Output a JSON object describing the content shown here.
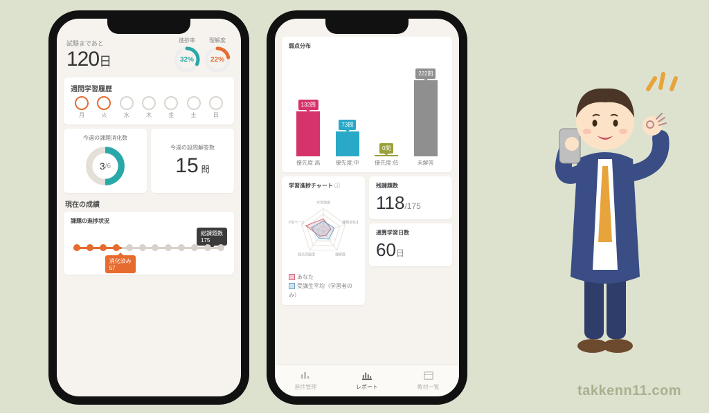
{
  "watermark": "takkenn11.com",
  "left": {
    "countdown": {
      "label": "試験まであと",
      "value": "120",
      "unit": "日"
    },
    "rings": [
      {
        "caption": "進捗率",
        "pct": 32,
        "text": "32%",
        "color": "#2aa8a8"
      },
      {
        "caption": "理解度",
        "pct": 22,
        "text": "22%",
        "color": "#e66b2e"
      }
    ],
    "weekly": {
      "title": "週間学習履歴",
      "days": [
        {
          "label": "月",
          "active": true
        },
        {
          "label": "火",
          "active": true
        },
        {
          "label": "水",
          "active": false
        },
        {
          "label": "木",
          "active": false
        },
        {
          "label": "金",
          "active": false
        },
        {
          "label": "土",
          "active": false
        },
        {
          "label": "日",
          "active": false
        }
      ]
    },
    "cards": {
      "tasks": {
        "title": "今週の課題消化数",
        "done": 3,
        "total": 6
      },
      "answers": {
        "title": "今週の設問解答数",
        "value": "15",
        "unit": "問"
      }
    },
    "grades_title": "現在の成績",
    "progress": {
      "title": "課題の進捗状況",
      "total_label": "総課題数",
      "total_value": "175",
      "done_label": "消化済み",
      "done_value": "57",
      "done_pct": 32,
      "dots_total": 12,
      "dots_done": 4
    }
  },
  "right": {
    "dist_title": "弱点分布",
    "remaining": {
      "title": "残課題数",
      "value": "118",
      "total": "/175"
    },
    "studydays": {
      "title": "通算学習日数",
      "value": "60",
      "unit": "日"
    },
    "radar": {
      "title": "学習進捗チャート",
      "axes": [
        "学習頻度",
        "課題消化率",
        "理解度",
        "弱点克服度",
        "学習ペース"
      ],
      "legend": {
        "you": "あなた",
        "avg": "受講生平均（学習者のみ）"
      }
    },
    "tabs": [
      {
        "label": "進捗管理",
        "active": false
      },
      {
        "label": "レポート",
        "active": true
      },
      {
        "label": "教材一覧",
        "active": false
      }
    ]
  },
  "chart_data": {
    "type": "bar",
    "title": "弱点分布",
    "ylabel": "問",
    "categories": [
      "優先度:高",
      "優先度:中",
      "優先度:低",
      "未解答"
    ],
    "values": [
      132,
      73,
      0,
      222
    ],
    "value_labels": [
      "132問",
      "73問",
      "0問",
      "222問"
    ],
    "colors": [
      "#d6336c",
      "#2aa8c7",
      "#9aa03a",
      "#8f8f8f"
    ],
    "ylim": [
      0,
      222
    ]
  },
  "radar_data": {
    "type": "radar",
    "axes": [
      "学習頻度",
      "課題消化率",
      "理解度",
      "弱点克服度",
      "学習ペース"
    ],
    "series": [
      {
        "name": "あなた",
        "color": "#d46a7e",
        "values": [
          0.55,
          0.35,
          0.2,
          0.25,
          0.8
        ]
      },
      {
        "name": "受講生平均",
        "color": "#6fa6c7",
        "values": [
          0.45,
          0.5,
          0.4,
          0.35,
          0.55
        ]
      }
    ],
    "scale": [
      0,
      1
    ]
  }
}
